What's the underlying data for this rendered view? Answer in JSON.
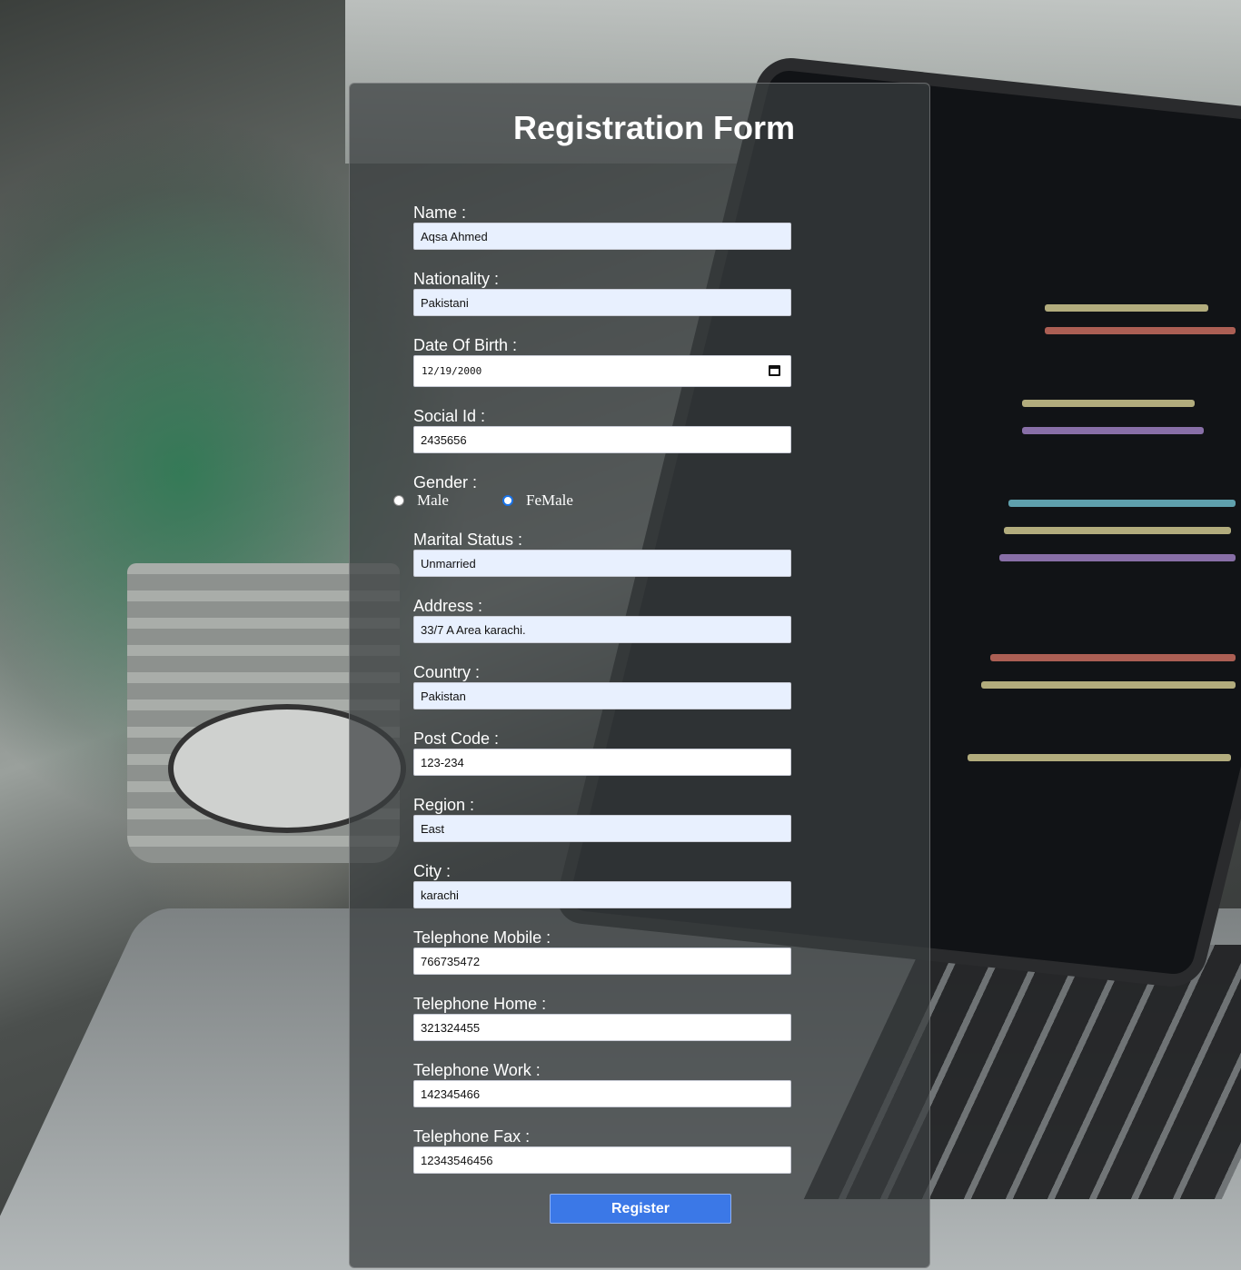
{
  "form": {
    "title": "Registration Form",
    "fields": [
      {
        "label": "Name :",
        "value": "Aqsa Ahmed"
      },
      {
        "label": "Nationality :",
        "value": "Pakistani"
      },
      {
        "label": "Date Of Birth :",
        "value": "12/19/2000"
      },
      {
        "label": "Social Id :",
        "value": "2435656"
      },
      {
        "label": "Gender :"
      },
      {
        "label": "Marital Status :",
        "value": "Unmarried"
      },
      {
        "label": "Address :",
        "value": "33/7 A Area karachi."
      },
      {
        "label": "Country :",
        "value": "Pakistan"
      },
      {
        "label": "Post Code :",
        "value": "123-234"
      },
      {
        "label": "Region :",
        "value": "East"
      },
      {
        "label": "City :",
        "value": "karachi"
      },
      {
        "label": "Telephone Mobile :",
        "value": "766735472"
      },
      {
        "label": "Telephone Home :",
        "value": "321324455"
      },
      {
        "label": "Telephone Work :",
        "value": "142345466"
      },
      {
        "label": "Telephone Fax :",
        "value": "12343546456"
      }
    ],
    "gender": {
      "options": [
        {
          "label": "Male",
          "checked": false
        },
        {
          "label": "FeMale",
          "checked": true
        }
      ]
    },
    "submit_label": "Register"
  },
  "colors": {
    "button": "#3b78e7",
    "input_autofill": "#e8f0fe",
    "card_overlay": "rgba(58,62,64,0.72)"
  },
  "icons": {
    "date_picker": "calendar-icon"
  }
}
